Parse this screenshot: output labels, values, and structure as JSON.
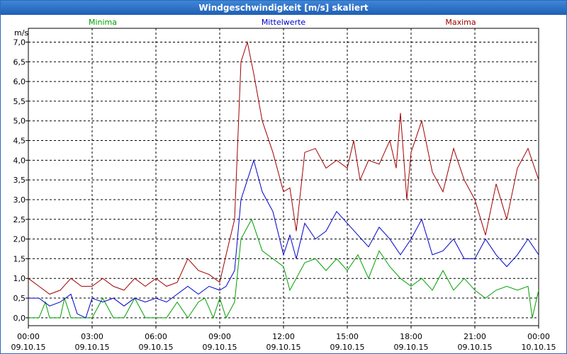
{
  "window": {
    "title": "Windgeschwindigkeit [m/s] skaliert"
  },
  "chart_data": {
    "type": "line",
    "title": "Windgeschwindigkeit [m/s] skaliert",
    "ylabel": "m/s",
    "ylim": [
      -0.2,
      7.35
    ],
    "y_ticks": [
      "0,0",
      "0,5",
      "1,0",
      "1,5",
      "2,0",
      "2,5",
      "3,0",
      "3,5",
      "4,0",
      "4,5",
      "5,0",
      "5,5",
      "6,0",
      "6,5",
      "7,0"
    ],
    "x_ticks": [
      {
        "time": "00:00",
        "date": "09.10.15"
      },
      {
        "time": "03:00",
        "date": "09.10.15"
      },
      {
        "time": "06:00",
        "date": "09.10.15"
      },
      {
        "time": "09:00",
        "date": "09.10.15"
      },
      {
        "time": "12:00",
        "date": "09.10.15"
      },
      {
        "time": "15:00",
        "date": "09.10.15"
      },
      {
        "time": "18:00",
        "date": "09.10.15"
      },
      {
        "time": "21:00",
        "date": "09.10.15"
      },
      {
        "time": "00:00",
        "date": "10.10.15"
      }
    ],
    "x_range_hours": [
      0,
      24
    ],
    "grid": true,
    "series": [
      {
        "name": "Minima",
        "color": "#00a000",
        "legend_pos": "left",
        "points": [
          [
            0,
            0.0
          ],
          [
            0.5,
            0.0
          ],
          [
            0.8,
            0.4
          ],
          [
            1.0,
            0.0
          ],
          [
            1.5,
            0.0
          ],
          [
            1.7,
            0.5
          ],
          [
            2.0,
            0.0
          ],
          [
            2.5,
            0.0
          ],
          [
            3.0,
            0.0
          ],
          [
            3.5,
            0.5
          ],
          [
            4.0,
            0.0
          ],
          [
            4.5,
            0.0
          ],
          [
            5.0,
            0.5
          ],
          [
            5.5,
            0.0
          ],
          [
            6.0,
            0.0
          ],
          [
            6.5,
            0.0
          ],
          [
            7.0,
            0.4
          ],
          [
            7.5,
            0.0
          ],
          [
            8.0,
            0.4
          ],
          [
            8.3,
            0.5
          ],
          [
            8.7,
            0.0
          ],
          [
            9.0,
            0.5
          ],
          [
            9.3,
            0.0
          ],
          [
            9.7,
            0.4
          ],
          [
            10.0,
            2.0
          ],
          [
            10.5,
            2.5
          ],
          [
            11.0,
            1.7
          ],
          [
            11.5,
            1.5
          ],
          [
            12.0,
            1.3
          ],
          [
            12.3,
            0.7
          ],
          [
            12.6,
            1.0
          ],
          [
            13.0,
            1.4
          ],
          [
            13.5,
            1.5
          ],
          [
            14.0,
            1.2
          ],
          [
            14.5,
            1.5
          ],
          [
            15.0,
            1.2
          ],
          [
            15.5,
            1.6
          ],
          [
            16.0,
            1.0
          ],
          [
            16.5,
            1.7
          ],
          [
            17.0,
            1.3
          ],
          [
            17.5,
            1.0
          ],
          [
            18.0,
            0.8
          ],
          [
            18.5,
            1.0
          ],
          [
            19.0,
            0.7
          ],
          [
            19.5,
            1.2
          ],
          [
            20.0,
            0.7
          ],
          [
            20.5,
            1.0
          ],
          [
            21.0,
            0.7
          ],
          [
            21.5,
            0.5
          ],
          [
            22.0,
            0.7
          ],
          [
            22.5,
            0.8
          ],
          [
            23.0,
            0.7
          ],
          [
            23.5,
            0.8
          ],
          [
            23.7,
            0.0
          ],
          [
            24.0,
            0.7
          ]
        ]
      },
      {
        "name": "Mittelwerte",
        "color": "#0000cc",
        "legend_pos": "center",
        "points": [
          [
            0,
            0.5
          ],
          [
            0.5,
            0.5
          ],
          [
            1.0,
            0.3
          ],
          [
            1.5,
            0.4
          ],
          [
            2.0,
            0.6
          ],
          [
            2.3,
            0.1
          ],
          [
            2.7,
            0.0
          ],
          [
            3.0,
            0.5
          ],
          [
            3.5,
            0.4
          ],
          [
            4.0,
            0.5
          ],
          [
            4.5,
            0.3
          ],
          [
            5.0,
            0.5
          ],
          [
            5.5,
            0.4
          ],
          [
            6.0,
            0.5
          ],
          [
            6.5,
            0.4
          ],
          [
            7.0,
            0.6
          ],
          [
            7.5,
            0.8
          ],
          [
            8.0,
            0.6
          ],
          [
            8.5,
            0.8
          ],
          [
            9.0,
            0.7
          ],
          [
            9.3,
            0.8
          ],
          [
            9.7,
            1.2
          ],
          [
            10.0,
            3.0
          ],
          [
            10.3,
            3.5
          ],
          [
            10.6,
            4.0
          ],
          [
            11.0,
            3.2
          ],
          [
            11.5,
            2.7
          ],
          [
            12.0,
            1.6
          ],
          [
            12.3,
            2.1
          ],
          [
            12.6,
            1.5
          ],
          [
            13.0,
            2.4
          ],
          [
            13.5,
            2.0
          ],
          [
            14.0,
            2.2
          ],
          [
            14.5,
            2.7
          ],
          [
            15.0,
            2.4
          ],
          [
            15.5,
            2.1
          ],
          [
            16.0,
            1.8
          ],
          [
            16.5,
            2.3
          ],
          [
            17.0,
            2.0
          ],
          [
            17.5,
            1.6
          ],
          [
            18.0,
            2.0
          ],
          [
            18.5,
            2.5
          ],
          [
            19.0,
            1.6
          ],
          [
            19.5,
            1.7
          ],
          [
            20.0,
            2.0
          ],
          [
            20.5,
            1.5
          ],
          [
            21.0,
            1.5
          ],
          [
            21.5,
            2.0
          ],
          [
            22.0,
            1.6
          ],
          [
            22.5,
            1.3
          ],
          [
            23.0,
            1.6
          ],
          [
            23.5,
            2.0
          ],
          [
            24.0,
            1.6
          ]
        ]
      },
      {
        "name": "Maxima",
        "color": "#a00000",
        "legend_pos": "right",
        "points": [
          [
            0,
            1.0
          ],
          [
            0.5,
            0.8
          ],
          [
            1.0,
            0.6
          ],
          [
            1.5,
            0.7
          ],
          [
            2.0,
            1.0
          ],
          [
            2.5,
            0.8
          ],
          [
            3.0,
            0.8
          ],
          [
            3.5,
            1.0
          ],
          [
            4.0,
            0.8
          ],
          [
            4.5,
            0.7
          ],
          [
            5.0,
            1.0
          ],
          [
            5.5,
            0.8
          ],
          [
            6.0,
            1.0
          ],
          [
            6.5,
            0.8
          ],
          [
            7.0,
            0.9
          ],
          [
            7.5,
            1.5
          ],
          [
            8.0,
            1.2
          ],
          [
            8.5,
            1.1
          ],
          [
            9.0,
            0.9
          ],
          [
            9.3,
            1.6
          ],
          [
            9.7,
            2.5
          ],
          [
            10.0,
            6.5
          ],
          [
            10.3,
            7.0
          ],
          [
            10.6,
            6.2
          ],
          [
            11.0,
            5.0
          ],
          [
            11.5,
            4.2
          ],
          [
            12.0,
            3.2
          ],
          [
            12.3,
            3.3
          ],
          [
            12.6,
            2.2
          ],
          [
            13.0,
            4.2
          ],
          [
            13.5,
            4.3
          ],
          [
            14.0,
            3.8
          ],
          [
            14.5,
            4.0
          ],
          [
            15.0,
            3.8
          ],
          [
            15.3,
            4.5
          ],
          [
            15.6,
            3.5
          ],
          [
            16.0,
            4.0
          ],
          [
            16.5,
            3.9
          ],
          [
            17.0,
            4.5
          ],
          [
            17.3,
            3.8
          ],
          [
            17.5,
            5.2
          ],
          [
            17.8,
            3.0
          ],
          [
            18.0,
            4.2
          ],
          [
            18.5,
            5.0
          ],
          [
            19.0,
            3.7
          ],
          [
            19.5,
            3.2
          ],
          [
            20.0,
            4.3
          ],
          [
            20.5,
            3.5
          ],
          [
            21.0,
            3.0
          ],
          [
            21.5,
            2.1
          ],
          [
            22.0,
            3.4
          ],
          [
            22.5,
            2.5
          ],
          [
            23.0,
            3.8
          ],
          [
            23.5,
            4.3
          ],
          [
            24.0,
            3.5
          ]
        ]
      }
    ]
  }
}
